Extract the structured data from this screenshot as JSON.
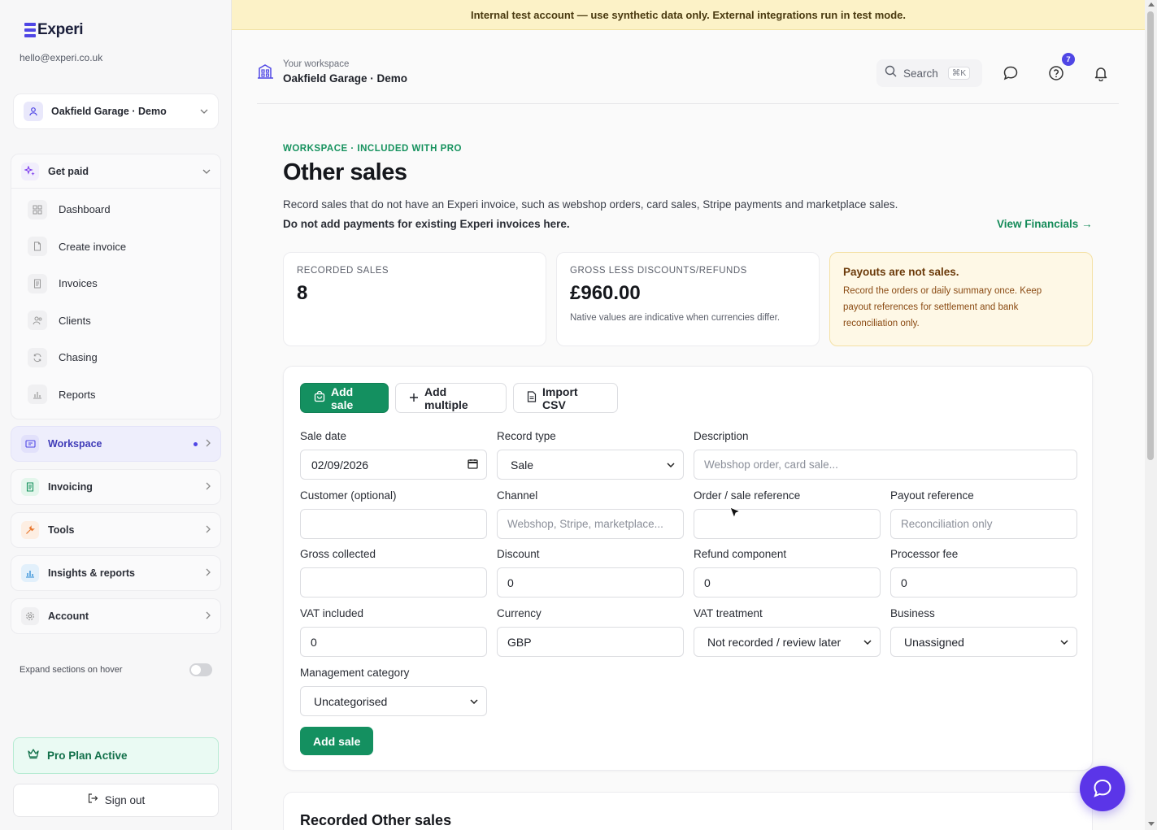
{
  "sidebar": {
    "brand": "Experi",
    "email": "hello@experi.co.uk",
    "account": "Oakfield Garage · Demo",
    "group": {
      "label": "Get paid",
      "items": [
        {
          "label": "Dashboard",
          "icon": "dashboard-icon"
        },
        {
          "label": "Create invoice",
          "icon": "create-invoice-icon"
        },
        {
          "label": "Invoices",
          "icon": "invoices-icon"
        },
        {
          "label": "Clients",
          "icon": "clients-icon"
        },
        {
          "label": "Chasing",
          "icon": "chasing-icon"
        },
        {
          "label": "Reports",
          "icon": "reports-icon"
        }
      ]
    },
    "sections": [
      {
        "label": "Workspace",
        "icon": "workspace-icon",
        "active": true
      },
      {
        "label": "Invoicing",
        "icon": "invoicing-icon"
      },
      {
        "label": "Tools",
        "icon": "tools-icon"
      },
      {
        "label": "Insights & reports",
        "icon": "insights-icon"
      },
      {
        "label": "Account",
        "icon": "gear-icon"
      }
    ],
    "expand_hover_label": "Expand sections on hover",
    "pro_plan": "Pro Plan Active",
    "sign_out": "Sign out"
  },
  "banner": "Internal test account — use synthetic data only. External integrations run in test mode.",
  "header": {
    "sub": "Your workspace",
    "name": "Oakfield Garage · Demo",
    "search": "Search",
    "shortcut": "⌘K",
    "help_badge": "7"
  },
  "page": {
    "eyebrow": "WORKSPACE · INCLUDED WITH PRO",
    "title": "Other sales",
    "desc": "Record sales that do not have an Experi invoice, such as webshop orders, card sales, Stripe payments and marketplace sales.",
    "desc_bold": "Do not add payments for existing Experi invoices here.",
    "view_financials": "View Financials →"
  },
  "stats": {
    "recorded_label": "RECORDED SALES",
    "recorded_value": "8",
    "gross_label": "GROSS LESS DISCOUNTS/REFUNDS",
    "gross_value": "£960.00",
    "gross_note": "Native values are indicative when currencies differ.",
    "warn_title": "Payouts are not sales.",
    "warn_text": "Record the orders or daily summary once. Keep payout references for settlement and bank reconciliation only."
  },
  "form": {
    "tabs": {
      "add_sale": "Add sale",
      "add_multiple": "Add multiple",
      "import_csv": "Import CSV"
    },
    "sale_date": {
      "label": "Sale date",
      "value": "02/09/2026"
    },
    "record_type": {
      "label": "Record type",
      "value": "Sale"
    },
    "description": {
      "label": "Description",
      "placeholder": "Webshop order, card sale..."
    },
    "customer": {
      "label": "Customer (optional)",
      "value": ""
    },
    "channel": {
      "label": "Channel",
      "placeholder": "Webshop, Stripe, marketplace..."
    },
    "order_ref": {
      "label": "Order / sale reference",
      "value": ""
    },
    "payout_ref": {
      "label": "Payout reference",
      "placeholder": "Reconciliation only"
    },
    "gross": {
      "label": "Gross collected",
      "value": ""
    },
    "discount": {
      "label": "Discount",
      "value": "0"
    },
    "refund": {
      "label": "Refund component",
      "value": "0"
    },
    "fee": {
      "label": "Processor fee",
      "value": "0"
    },
    "vat_included": {
      "label": "VAT included",
      "value": "0"
    },
    "currency": {
      "label": "Currency",
      "value": "GBP"
    },
    "vat_treatment": {
      "label": "VAT treatment",
      "value": "Not recorded / review later"
    },
    "business": {
      "label": "Business",
      "value": "Unassigned"
    },
    "mgmt_category": {
      "label": "Management category",
      "value": "Uncategorised"
    },
    "submit": "Add sale"
  },
  "recorded_section": {
    "title": "Recorded Other sales"
  },
  "colors": {
    "accent": "#149060",
    "brand": "#4f46e5",
    "banner": "#fcf2c7",
    "warn": "#fef8e6",
    "fab": "#5b35e8"
  }
}
